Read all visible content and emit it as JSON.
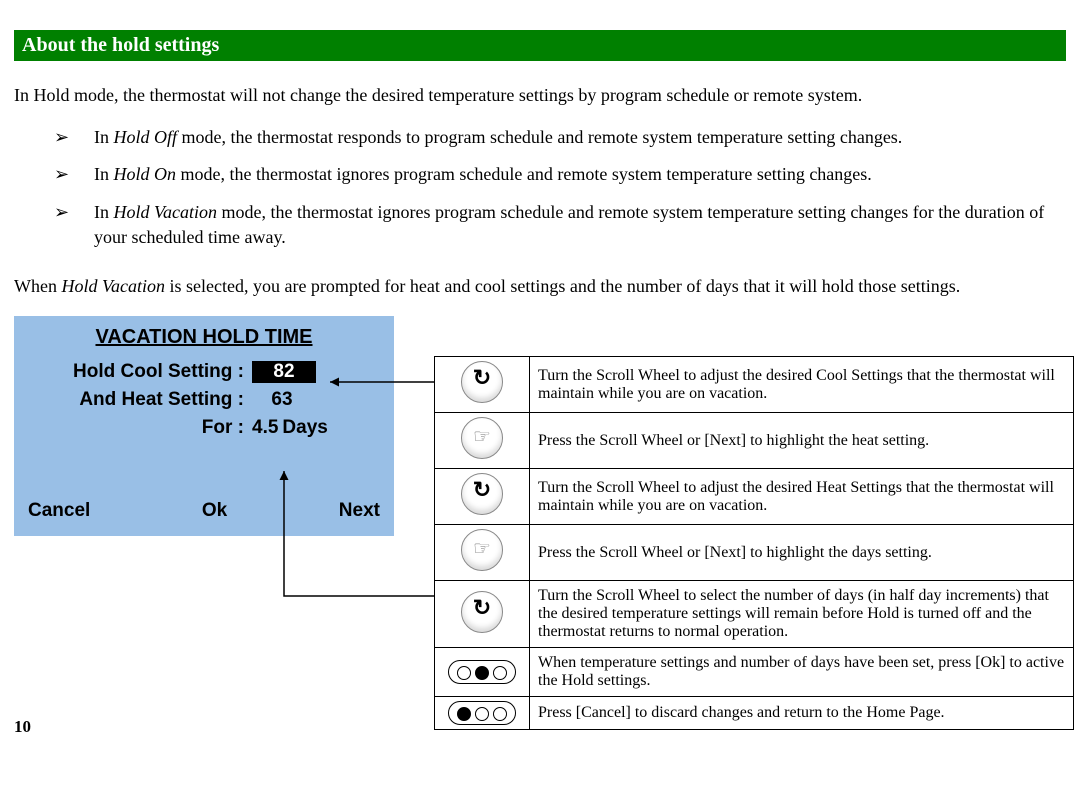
{
  "section_title": "About the hold settings",
  "intro": "In Hold mode, the thermostat will not change the desired temperature settings by program schedule or remote system.",
  "bullets": [
    {
      "mode": "Hold Off",
      "text": " mode, the thermostat responds to program schedule and remote system temperature setting changes."
    },
    {
      "mode": "Hold On",
      "text": " mode, the thermostat ignores program schedule and remote system temperature setting changes."
    },
    {
      "mode": "Hold Vacation",
      "text": " mode, the thermostat ignores program schedule and remote system temperature setting changes for the duration of your scheduled time away."
    }
  ],
  "followup_pre": "When ",
  "followup_mode": "Hold Vacation",
  "followup_post": " is selected, you are prompted for heat and cool settings and the number of days that it will hold those settings.",
  "lcd": {
    "title": "VACATION HOLD TIME",
    "cool_label": "Hold Cool Setting :",
    "cool_value": "82",
    "heat_label": "And Heat Setting :",
    "heat_value": "63",
    "for_label": "For :",
    "for_value": "4.5",
    "for_unit": "Days",
    "btn_cancel": "Cancel",
    "btn_ok": "Ok",
    "btn_next": "Next"
  },
  "instructions": [
    {
      "icon": "turn",
      "text": "Turn the Scroll Wheel to adjust the desired Cool Settings that the thermostat will maintain while you are on vacation."
    },
    {
      "icon": "press",
      "text": "Press the Scroll Wheel or [Next] to highlight the heat setting."
    },
    {
      "icon": "turn",
      "text": "Turn the Scroll Wheel to adjust the desired Heat Settings that the thermostat will maintain while you are on vacation."
    },
    {
      "icon": "press",
      "text": "Press the Scroll Wheel or [Next] to highlight the days setting."
    },
    {
      "icon": "turn",
      "text": "Turn the Scroll Wheel to select the number of days (in half day increments) that the desired temperature settings will remain before Hold is turned off and the thermostat returns to normal operation."
    },
    {
      "icon": "ok",
      "text": "When temperature settings and number of days have been set, press [Ok] to active the Hold settings."
    },
    {
      "icon": "cancel",
      "text": "Press [Cancel] to discard changes and return to the Home Page."
    }
  ],
  "page_number": "10",
  "icons": {
    "turn": "rotate-icon",
    "press": "touch-icon",
    "ok": "ok-button-icon",
    "cancel": "cancel-button-icon"
  }
}
